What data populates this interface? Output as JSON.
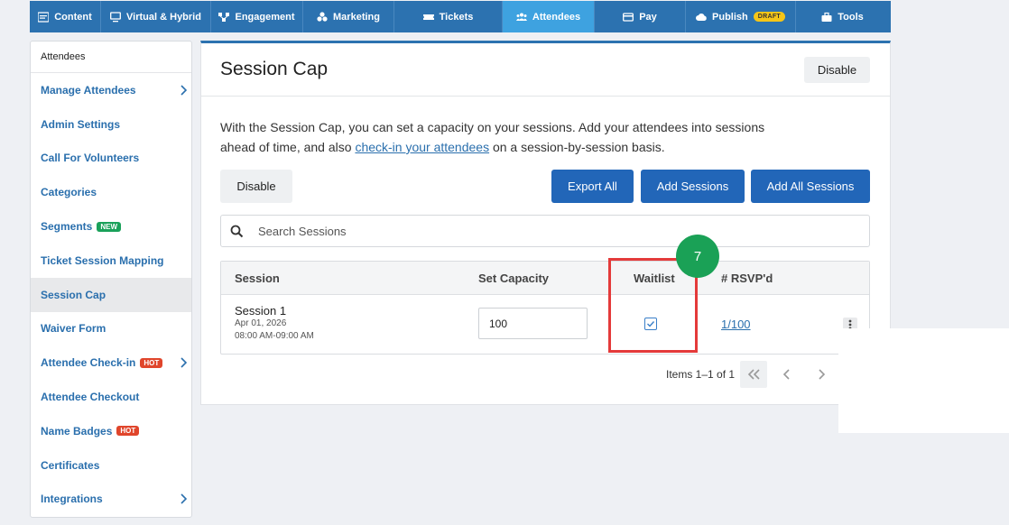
{
  "nav": {
    "items": [
      {
        "label": "Content",
        "icon": "content-icon"
      },
      {
        "label": "Virtual & Hybrid",
        "icon": "monitor-icon"
      },
      {
        "label": "Engagement",
        "icon": "engagement-icon"
      },
      {
        "label": "Marketing",
        "icon": "marketing-icon"
      },
      {
        "label": "Tickets",
        "icon": "ticket-icon"
      },
      {
        "label": "Attendees",
        "icon": "attendees-icon",
        "active": true
      },
      {
        "label": "Pay",
        "icon": "card-icon"
      },
      {
        "label": "Publish",
        "icon": "cloud-icon",
        "badge": "DRAFT"
      },
      {
        "label": "Tools",
        "icon": "toolbox-icon"
      }
    ]
  },
  "sidebar": {
    "heading": "Attendees",
    "items": [
      {
        "label": "Manage Attendees",
        "chevron": true
      },
      {
        "label": "Admin Settings"
      },
      {
        "label": "Call For Volunteers"
      },
      {
        "label": "Categories"
      },
      {
        "label": "Segments",
        "badge": "NEW"
      },
      {
        "label": "Ticket Session Mapping"
      },
      {
        "label": "Session Cap",
        "active": true
      },
      {
        "label": "Waiver Form"
      },
      {
        "label": "Attendee Check-in",
        "badge": "HOT",
        "chevron": true
      },
      {
        "label": "Attendee Checkout"
      },
      {
        "label": "Name Badges",
        "badge": "HOT"
      },
      {
        "label": "Certificates"
      },
      {
        "label": "Integrations",
        "chevron": true
      }
    ]
  },
  "main": {
    "title": "Session Cap",
    "header_disable_label": "Disable",
    "description_part1": "With the Session Cap, you can set a capacity on your sessions. Add your attendees into sessions ahead of time, and also ",
    "description_link": "check-in your attendees",
    "description_part2": " on a session-by-session basis.",
    "disable_label": "Disable",
    "export_all_label": "Export All",
    "add_sessions_label": "Add Sessions",
    "add_all_sessions_label": "Add All Sessions",
    "search_placeholder": "Search Sessions",
    "table": {
      "columns": [
        "Session",
        "Set Capacity",
        "Waitlist",
        "# RSVP'd"
      ],
      "rows": [
        {
          "name": "Session 1",
          "date": "Apr 01, 2026",
          "time": "08:00 AM-09:00 AM",
          "capacity": "100",
          "waitlist": true,
          "rsvp": "1/100"
        }
      ]
    },
    "pager_text": "Items 1–1 of 1"
  },
  "annotation": {
    "step": "7"
  },
  "colors": {
    "nav_bg": "#2c72b0",
    "nav_active": "#3ea2e0",
    "primary_button": "#2266b8",
    "link": "#2a6fad",
    "highlight": "#e43a3a",
    "step_badge": "#1aa156"
  }
}
